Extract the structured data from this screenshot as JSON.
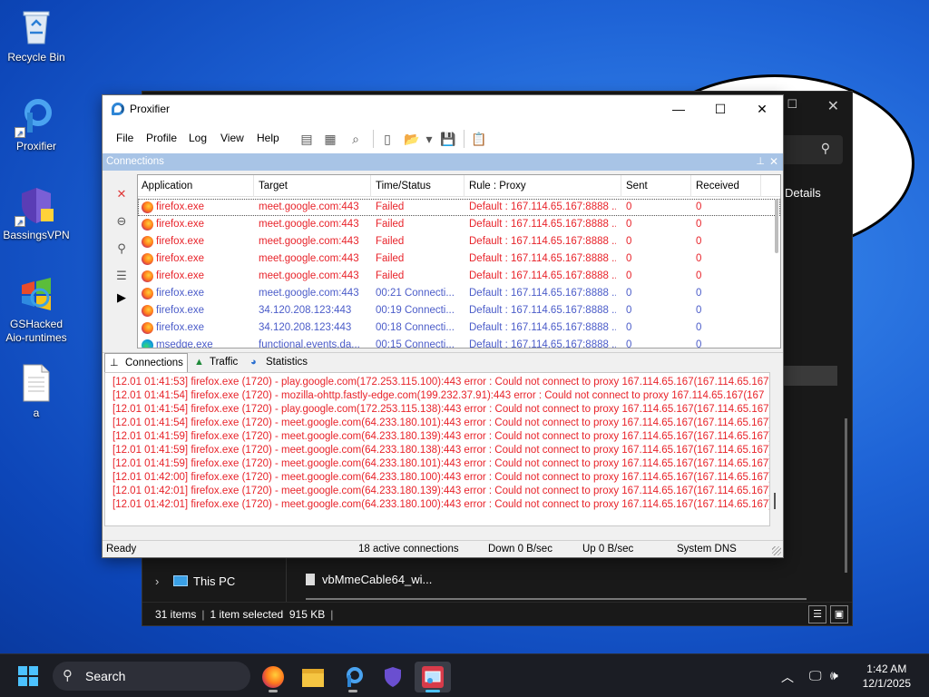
{
  "desktop": {
    "icons": [
      {
        "label": "Recycle Bin"
      },
      {
        "label": "Proxifier"
      },
      {
        "label": "BassingsVPN"
      },
      {
        "label_line1": "GSHacked",
        "label_line2": "Aio-runtimes"
      },
      {
        "label": "a"
      }
    ]
  },
  "explorer": {
    "details_label": "Details",
    "nav_item": "This PC",
    "file_name": "vbMmeCable64_wi...",
    "status_items": "31 items",
    "status_selected": "1 item selected",
    "status_size": "915 KB"
  },
  "window": {
    "title": "Proxifier",
    "menu": [
      "File",
      "Profile",
      "Log",
      "View",
      "Help"
    ]
  },
  "connections": {
    "pane_title": "Connections",
    "columns": [
      "Application",
      "Target",
      "Time/Status",
      "Rule : Proxy",
      "Sent",
      "Received"
    ],
    "rows": [
      {
        "icon": "firefox",
        "state": "failed",
        "app": "firefox.exe",
        "target": "meet.google.com:443",
        "status": "Failed",
        "rule": "Default : 167.114.65.167:8888 ...",
        "sent": "0",
        "received": "0"
      },
      {
        "icon": "firefox",
        "state": "failed",
        "app": "firefox.exe",
        "target": "meet.google.com:443",
        "status": "Failed",
        "rule": "Default : 167.114.65.167:8888 ...",
        "sent": "0",
        "received": "0"
      },
      {
        "icon": "firefox",
        "state": "failed",
        "app": "firefox.exe",
        "target": "meet.google.com:443",
        "status": "Failed",
        "rule": "Default : 167.114.65.167:8888 ...",
        "sent": "0",
        "received": "0"
      },
      {
        "icon": "firefox",
        "state": "failed",
        "app": "firefox.exe",
        "target": "meet.google.com:443",
        "status": "Failed",
        "rule": "Default : 167.114.65.167:8888 ...",
        "sent": "0",
        "received": "0"
      },
      {
        "icon": "firefox",
        "state": "failed",
        "app": "firefox.exe",
        "target": "meet.google.com:443",
        "status": "Failed",
        "rule": "Default : 167.114.65.167:8888 ...",
        "sent": "0",
        "received": "0"
      },
      {
        "icon": "firefox",
        "state": "active",
        "app": "firefox.exe",
        "target": "meet.google.com:443",
        "status": "00:21 Connecti...",
        "rule": "Default : 167.114.65.167:8888 ...",
        "sent": "0",
        "received": "0"
      },
      {
        "icon": "firefox",
        "state": "active",
        "app": "firefox.exe",
        "target": "34.120.208.123:443",
        "status": "00:19 Connecti...",
        "rule": "Default : 167.114.65.167:8888 ...",
        "sent": "0",
        "received": "0"
      },
      {
        "icon": "firefox",
        "state": "active",
        "app": "firefox.exe",
        "target": "34.120.208.123:443",
        "status": "00:18 Connecti...",
        "rule": "Default : 167.114.65.167:8888 ...",
        "sent": "0",
        "received": "0"
      },
      {
        "icon": "edge",
        "state": "active",
        "app": "msedge.exe",
        "target": "functional.events.da...",
        "status": "00:15 Connecti...",
        "rule": "Default : 167.114.65.167:8888 ...",
        "sent": "0",
        "received": "0"
      }
    ]
  },
  "tabs": [
    "Connections",
    "Traffic",
    "Statistics"
  ],
  "log": [
    "[12.01 01:41:53] firefox.exe (1720) - play.google.com(172.253.115.100):443 error : Could not connect to proxy 167.114.65.167(167.114.65.167",
    "[12.01 01:41:54] firefox.exe (1720) - mozilla-ohttp.fastly-edge.com(199.232.37.91):443 error : Could not connect to proxy 167.114.65.167(167",
    "[12.01 01:41:54] firefox.exe (1720) - play.google.com(172.253.115.138):443 error : Could not connect to proxy 167.114.65.167(167.114.65.167",
    "[12.01 01:41:54] firefox.exe (1720) - meet.google.com(64.233.180.101):443 error : Could not connect to proxy 167.114.65.167(167.114.65.167)",
    "[12.01 01:41:59] firefox.exe (1720) - meet.google.com(64.233.180.139):443 error : Could not connect to proxy 167.114.65.167(167.114.65.167)",
    "[12.01 01:41:59] firefox.exe (1720) - meet.google.com(64.233.180.138):443 error : Could not connect to proxy 167.114.65.167(167.114.65.167)",
    "[12.01 01:41:59] firefox.exe (1720) - meet.google.com(64.233.180.101):443 error : Could not connect to proxy 167.114.65.167(167.114.65.167)",
    "[12.01 01:42:00] firefox.exe (1720) - meet.google.com(64.233.180.100):443 error : Could not connect to proxy 167.114.65.167(167.114.65.167)",
    "[12.01 01:42:01] firefox.exe (1720) - meet.google.com(64.233.180.139):443 error : Could not connect to proxy 167.114.65.167(167.114.65.167)",
    "[12.01 01:42:01] firefox.exe (1720) - meet.google.com(64.233.180.100):443 error : Could not connect to proxy 167.114.65.167(167.114.65.167)"
  ],
  "status": {
    "ready": "Ready",
    "active": "18 active connections",
    "down": "Down 0 B/sec",
    "up": "Up 0 B/sec",
    "dns": "System DNS"
  },
  "taskbar": {
    "search_label": "Search",
    "time": "1:42 AM",
    "date": "12/1/2025"
  },
  "colors": {
    "failed_text": "#e8232a",
    "active_text": "#4b5cc9",
    "pane_header": "#a8c4e6"
  }
}
